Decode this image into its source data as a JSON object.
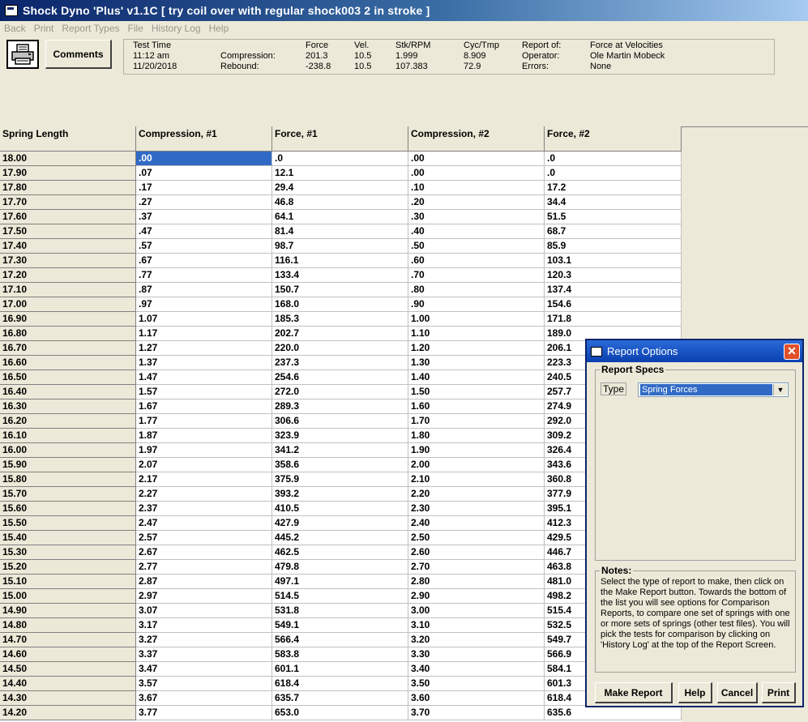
{
  "window": {
    "title": "Shock Dyno 'Plus' v1.1C  [ try coil over with regular shock003 2 in stroke ]"
  },
  "menu": [
    "Back",
    "Print",
    "Report Types",
    "File",
    "History Log",
    "Help"
  ],
  "toolbar": {
    "comments_label": "Comments",
    "print_icon": "printer-icon"
  },
  "info": {
    "test_time_label": "Test Time",
    "time": "11:12 am",
    "date": "11/20/2018",
    "compression_label": "Compression:",
    "rebound_label": "Rebound:",
    "force_label": "Force",
    "vel_label": "Vel.",
    "stk_label": "Stk/RPM",
    "cyc_label": "Cyc/Tmp",
    "comp_force": "201.3",
    "comp_vel": "10.5",
    "comp_stk": "1.999",
    "comp_cyc": "8.909",
    "reb_force": "-238.8",
    "reb_vel": "10.5",
    "reb_stk": "107.383",
    "reb_cyc": "72.9",
    "report_of_label": "Report of:",
    "operator_label": "Operator:",
    "errors_label": "Errors:",
    "report_of": "Force at Velocities",
    "operator": "Ole Martin Mobeck",
    "errors": "None"
  },
  "table": {
    "headers": [
      "Spring Length",
      "Compression, #1",
      "Force, #1",
      "Compression, #2",
      "Force, #2"
    ],
    "rows": [
      [
        "18.00",
        ".00",
        ".0",
        ".00",
        ".0"
      ],
      [
        "17.90",
        ".07",
        "12.1",
        ".00",
        ".0"
      ],
      [
        "17.80",
        ".17",
        "29.4",
        ".10",
        "17.2"
      ],
      [
        "17.70",
        ".27",
        "46.8",
        ".20",
        "34.4"
      ],
      [
        "17.60",
        ".37",
        "64.1",
        ".30",
        "51.5"
      ],
      [
        "17.50",
        ".47",
        "81.4",
        ".40",
        "68.7"
      ],
      [
        "17.40",
        ".57",
        "98.7",
        ".50",
        "85.9"
      ],
      [
        "17.30",
        ".67",
        "116.1",
        ".60",
        "103.1"
      ],
      [
        "17.20",
        ".77",
        "133.4",
        ".70",
        "120.3"
      ],
      [
        "17.10",
        ".87",
        "150.7",
        ".80",
        "137.4"
      ],
      [
        "17.00",
        ".97",
        "168.0",
        ".90",
        "154.6"
      ],
      [
        "16.90",
        "1.07",
        "185.3",
        "1.00",
        "171.8"
      ],
      [
        "16.80",
        "1.17",
        "202.7",
        "1.10",
        "189.0"
      ],
      [
        "16.70",
        "1.27",
        "220.0",
        "1.20",
        "206.1"
      ],
      [
        "16.60",
        "1.37",
        "237.3",
        "1.30",
        "223.3"
      ],
      [
        "16.50",
        "1.47",
        "254.6",
        "1.40",
        "240.5"
      ],
      [
        "16.40",
        "1.57",
        "272.0",
        "1.50",
        "257.7"
      ],
      [
        "16.30",
        "1.67",
        "289.3",
        "1.60",
        "274.9"
      ],
      [
        "16.20",
        "1.77",
        "306.6",
        "1.70",
        "292.0"
      ],
      [
        "16.10",
        "1.87",
        "323.9",
        "1.80",
        "309.2"
      ],
      [
        "16.00",
        "1.97",
        "341.2",
        "1.90",
        "326.4"
      ],
      [
        "15.90",
        "2.07",
        "358.6",
        "2.00",
        "343.6"
      ],
      [
        "15.80",
        "2.17",
        "375.9",
        "2.10",
        "360.8"
      ],
      [
        "15.70",
        "2.27",
        "393.2",
        "2.20",
        "377.9"
      ],
      [
        "15.60",
        "2.37",
        "410.5",
        "2.30",
        "395.1"
      ],
      [
        "15.50",
        "2.47",
        "427.9",
        "2.40",
        "412.3"
      ],
      [
        "15.40",
        "2.57",
        "445.2",
        "2.50",
        "429.5"
      ],
      [
        "15.30",
        "2.67",
        "462.5",
        "2.60",
        "446.7"
      ],
      [
        "15.20",
        "2.77",
        "479.8",
        "2.70",
        "463.8"
      ],
      [
        "15.10",
        "2.87",
        "497.1",
        "2.80",
        "481.0"
      ],
      [
        "15.00",
        "2.97",
        "514.5",
        "2.90",
        "498.2"
      ],
      [
        "14.90",
        "3.07",
        "531.8",
        "3.00",
        "515.4"
      ],
      [
        "14.80",
        "3.17",
        "549.1",
        "3.10",
        "532.5"
      ],
      [
        "14.70",
        "3.27",
        "566.4",
        "3.20",
        "549.7"
      ],
      [
        "14.60",
        "3.37",
        "583.8",
        "3.30",
        "566.9"
      ],
      [
        "14.50",
        "3.47",
        "601.1",
        "3.40",
        "584.1"
      ],
      [
        "14.40",
        "3.57",
        "618.4",
        "3.50",
        "601.3"
      ],
      [
        "14.30",
        "3.67",
        "635.7",
        "3.60",
        "618.4"
      ],
      [
        "14.20",
        "3.77",
        "653.0",
        "3.70",
        "635.6"
      ]
    ]
  },
  "dialog": {
    "title": "Report Options",
    "specs_label": "Report Specs",
    "type_label": "Type",
    "type_value": "Spring Forces",
    "notes_label": "Notes:",
    "notes_text": "Select the type of report to make, then click on the Make Report button.  Towards the bottom of the list you will see options for Comparison Reports, to compare one set of springs with one or more sets of springs (other test files).  You will pick the tests for comparison by clicking on 'History Log' at the top of the Report Screen.",
    "make_report_label": "Make Report",
    "help_label": "Help",
    "cancel_label": "Cancel",
    "print_label": "Print",
    "close_glyph": "✕"
  }
}
